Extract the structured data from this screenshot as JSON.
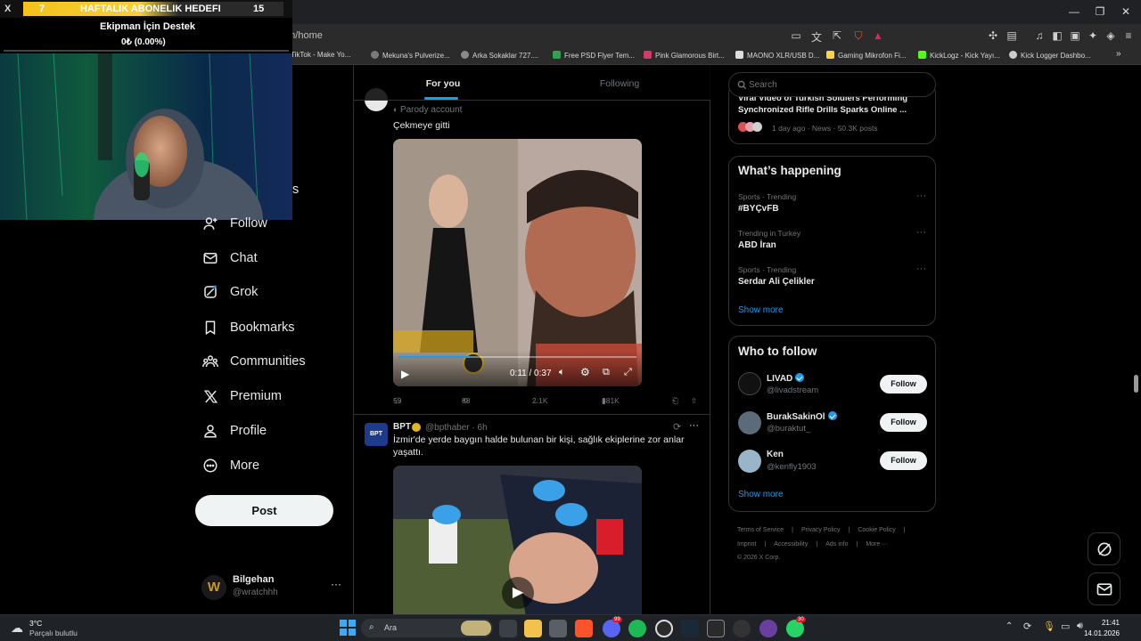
{
  "browser": {
    "url": "om/home",
    "bookmarks": [
      "TikTok - Make Yo...",
      "Mekuna's Pulverize...",
      "Arka Sokaklar 727....",
      "Free PSD Flyer Tem...",
      "Pink Glamorous Birt...",
      "MAONO XLR/USB D...",
      "Gaming Mikrofon Fi...",
      "KickLogz - Kick Yayı...",
      "Kick Logger Dashbo..."
    ],
    "bookmarks_more": "»",
    "window": {
      "minimize": "—",
      "maximize": "❐",
      "close": "✕"
    }
  },
  "overlay": {
    "left_number": "7",
    "goal_title": "HAFTALIK ABONELIK HEDEFI",
    "right_number": "15",
    "support_title": "Ekipman İçin Destek",
    "support_progress": "0₺ (0.00%)",
    "support_fraction": 0,
    "close_mark": "X"
  },
  "nav": {
    "partial_label": "s",
    "items": [
      {
        "label": "Follow",
        "icon": "follow-icon"
      },
      {
        "label": "Chat",
        "icon": "chat-icon"
      },
      {
        "label": "Grok",
        "icon": "grok-icon"
      },
      {
        "label": "Bookmarks",
        "icon": "bookmark-icon"
      },
      {
        "label": "Communities",
        "icon": "communities-icon"
      },
      {
        "label": "Premium",
        "icon": "x-logo-icon"
      },
      {
        "label": "Profile",
        "icon": "profile-icon"
      },
      {
        "label": "More",
        "icon": "more-circle-icon"
      }
    ],
    "post_label": "Post",
    "account": {
      "name": "Bilgehan",
      "handle": "@wratchhh",
      "more": "···"
    }
  },
  "timeline": {
    "tabs": [
      "For you",
      "Following"
    ],
    "tweet1": {
      "parody": "Parody account",
      "text": "Çekmeye gitti",
      "video_time": "0:11 / 0:37",
      "video_progress": 0.3,
      "stats": {
        "replies": "59",
        "reposts": "88",
        "likes": "2.1K",
        "views": "381K"
      }
    },
    "tweet2": {
      "name": "BPT",
      "handle_time": "@bpthaber · 6h",
      "text_line1": "İzmir'de yerde baygın halde bulunan bir kişi, sağlık ekiplerine zor anlar",
      "text_line2": "yaşattı.",
      "avatar_text": "BPT",
      "more": "···"
    }
  },
  "right": {
    "search_placeholder": "Search",
    "news": {
      "headline_line1": "Viral Video of Turkish Soldiers Performing",
      "headline_line2": "Synchronized Rifle Drills Sparks Online ...",
      "meta": "1 day ago · News · 50.3K posts"
    },
    "whats_happening": {
      "title": "What’s happening",
      "trends": [
        {
          "category": "Sports · Trending",
          "name": "#BYÇvFB"
        },
        {
          "category": "Trending in Turkey",
          "name": "ABD İran"
        },
        {
          "category": "Sports · Trending",
          "name": "Serdar Ali Çelikler"
        }
      ],
      "more": "···",
      "show_more": "Show more"
    },
    "who_to_follow": {
      "title": "Who to follow",
      "users": [
        {
          "name": "LIVAD",
          "handle": "@livadstream",
          "verified": true
        },
        {
          "name": "BurakSakinOl",
          "handle": "@buraktut_",
          "verified": true
        },
        {
          "name": "Ken",
          "handle": "@kenfly1903",
          "verified": false
        }
      ],
      "follow_label": "Follow",
      "show_more": "Show more"
    },
    "footer": [
      "Terms of Service",
      "|",
      "Privacy Policy",
      "|",
      "Cookie Policy",
      "|",
      "Imprint",
      "|",
      "Accessibility",
      "|",
      "Ads info",
      "|",
      "More ···",
      "© 2026 X Corp."
    ]
  },
  "taskbar": {
    "weather_temp": "3°C",
    "weather_desc": "Parçalı bulutlu",
    "search_placeholder": "Ara",
    "time": "21:41",
    "date": "14.01.2026",
    "badges": {
      "discord": "99",
      "whatsapp": "30"
    }
  }
}
